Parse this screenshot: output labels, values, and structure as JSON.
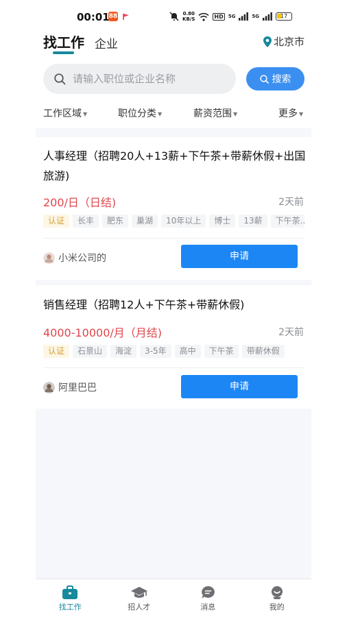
{
  "status_bar": {
    "time": "00:01",
    "app_badge": "88",
    "net_speed_value": "0.80",
    "net_speed_unit": "KB/S",
    "hd_label": "HD",
    "signal_label": "5G",
    "battery": "17"
  },
  "header": {
    "tab_main": "找工作",
    "tab_second": "企业",
    "city": "北京市"
  },
  "search": {
    "placeholder": "请输入职位或企业名称",
    "button_label": "搜索"
  },
  "filters": [
    "工作区域",
    "职位分类",
    "薪资范围",
    "更多"
  ],
  "jobs": [
    {
      "title": "人事经理（招聘20人+13薪+下午茶+带薪休假+出国旅游)",
      "salary": "200/日（日结)",
      "posted": "2天前",
      "tags": [
        "认证",
        "长丰",
        "肥东",
        "巢湖",
        "10年以上",
        "博士",
        "13薪",
        "下午茶..."
      ],
      "company": "小米公司的",
      "apply_label": "申请"
    },
    {
      "title": "销售经理（招聘12人+下午茶+带薪休假)",
      "salary": "4000-10000/月（月结)",
      "posted": "2天前",
      "tags": [
        "认证",
        "石景山",
        "海淀",
        "3-5年",
        "高中",
        "下午茶",
        "带薪休假"
      ],
      "company": "阿里巴巴",
      "apply_label": "申请"
    }
  ],
  "bottom_nav": [
    {
      "label": "找工作",
      "icon": "briefcase-icon",
      "active": true
    },
    {
      "label": "招人才",
      "icon": "graduation-cap-icon",
      "active": false
    },
    {
      "label": "消息",
      "icon": "message-icon",
      "active": false
    },
    {
      "label": "我的",
      "icon": "profile-icon",
      "active": false
    }
  ],
  "colors": {
    "accent": "#17899c",
    "button_blue": "#1d86f5",
    "salary_red": "#e0464c",
    "cert_gold": "#d6a13e"
  }
}
